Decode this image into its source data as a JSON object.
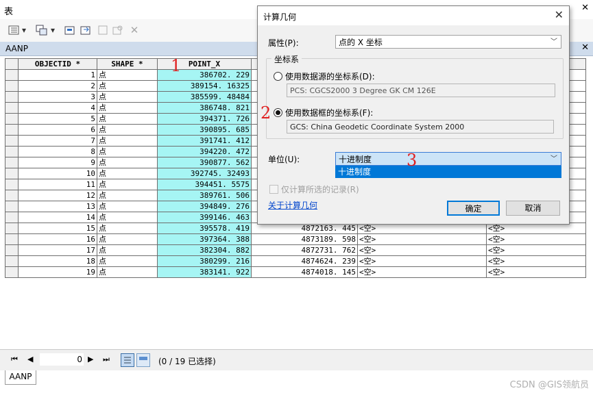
{
  "window": {
    "title": "表",
    "controls": "✕"
  },
  "toolbar": {
    "icons": [
      "table-options-icon",
      "dropdown-icon",
      "related-tables-icon",
      "dropdown-icon",
      "select-by-attributes-icon",
      "switch-selection-icon",
      "clear-selection-icon",
      "zoom-selected-icon",
      "delete-selected-icon"
    ]
  },
  "tab": {
    "name": "AANP",
    "close": "✕"
  },
  "table": {
    "columns": [
      "OBJECTID *",
      "SHAPE *",
      "POINT_X"
    ],
    "rows": [
      {
        "oid": "1",
        "shape": "点",
        "x": "386702. 229",
        "y": "",
        "e1": "",
        "e2": ""
      },
      {
        "oid": "2",
        "shape": "点",
        "x": "389154. 16325",
        "y": "",
        "e1": "",
        "e2": ""
      },
      {
        "oid": "3",
        "shape": "点",
        "x": "385599. 48484",
        "y": "",
        "e1": "",
        "e2": ""
      },
      {
        "oid": "4",
        "shape": "点",
        "x": "386748. 821",
        "y": "",
        "e1": "",
        "e2": ""
      },
      {
        "oid": "5",
        "shape": "点",
        "x": "394371. 726",
        "y": "",
        "e1": "",
        "e2": ""
      },
      {
        "oid": "6",
        "shape": "点",
        "x": "390895. 685",
        "y": "",
        "e1": "",
        "e2": ""
      },
      {
        "oid": "7",
        "shape": "点",
        "x": "391741. 412",
        "y": "",
        "e1": "",
        "e2": ""
      },
      {
        "oid": "8",
        "shape": "点",
        "x": "394220. 472",
        "y": "",
        "e1": "",
        "e2": ""
      },
      {
        "oid": "9",
        "shape": "点",
        "x": "390877. 562",
        "y": "",
        "e1": "",
        "e2": ""
      },
      {
        "oid": "10",
        "shape": "点",
        "x": "392745. 32493",
        "y": "",
        "e1": "",
        "e2": ""
      },
      {
        "oid": "11",
        "shape": "点",
        "x": "394451. 5575",
        "y": "",
        "e1": "",
        "e2": ""
      },
      {
        "oid": "12",
        "shape": "点",
        "x": "389761. 506",
        "y": "",
        "e1": "",
        "e2": ""
      },
      {
        "oid": "13",
        "shape": "点",
        "x": "394849. 276",
        "y": "",
        "e1": "",
        "e2": ""
      },
      {
        "oid": "14",
        "shape": "点",
        "x": "399146. 463",
        "y": "",
        "e1": "",
        "e2": ""
      },
      {
        "oid": "15",
        "shape": "点",
        "x": "395578. 419",
        "y": "4872163. 445",
        "e1": "<空>",
        "e2": "<空>"
      },
      {
        "oid": "16",
        "shape": "点",
        "x": "397364. 388",
        "y": "4873189. 598",
        "e1": "<空>",
        "e2": "<空>"
      },
      {
        "oid": "17",
        "shape": "点",
        "x": "382304. 882",
        "y": "4872731. 762",
        "e1": "<空>",
        "e2": "<空>"
      },
      {
        "oid": "18",
        "shape": "点",
        "x": "380299. 216",
        "y": "4874624. 239",
        "e1": "<空>",
        "e2": "<空>"
      },
      {
        "oid": "19",
        "shape": "点",
        "x": "383141. 922",
        "y": "4874018. 145",
        "e1": "<空>",
        "e2": "<空>"
      }
    ]
  },
  "status": {
    "nav": {
      "first": "⏮",
      "prev": "◀",
      "next": "▶",
      "last": "⏭"
    },
    "page_value": "0",
    "selection": "(0 / 19 已选择)"
  },
  "bottom_tab": "AANP",
  "watermark": "CSDN @GIS领航员",
  "dialog": {
    "title": "计算几何",
    "close": "✕",
    "property_label": "属性(P):",
    "property_value": "点的 X 坐标",
    "coord_group": "坐标系",
    "radio_source": "使用数据源的坐标系(D):",
    "source_cs": "PCS: CGCS2000 3 Degree GK CM 126E",
    "radio_frame": "使用数据框的坐标系(F):",
    "frame_cs": "GCS: China Geodetic Coordinate System 2000",
    "unit_label": "单位(U):",
    "unit_value": "十进制度",
    "unit_option": "十进制度",
    "selected_only": "仅计算所选的记录(R)",
    "about_link": "关于计算几何",
    "ok": "确定",
    "cancel": "取消"
  },
  "annotations": {
    "m1": "1",
    "m2": "2",
    "m3": "3",
    "color": "#e02020"
  }
}
